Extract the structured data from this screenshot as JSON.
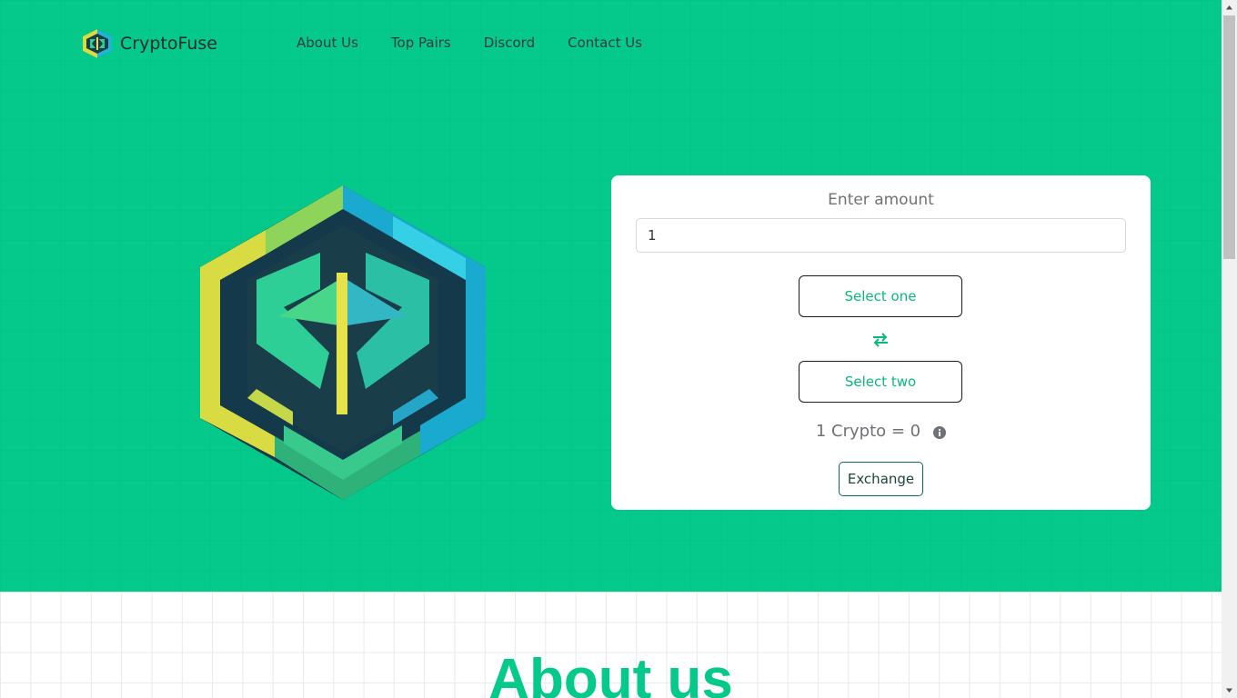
{
  "brand": {
    "name": "CryptoFuse",
    "logo_icon": "cryptofuse-logo-icon"
  },
  "nav": {
    "items": [
      {
        "label": "About Us"
      },
      {
        "label": "Top Pairs"
      },
      {
        "label": "Discord"
      },
      {
        "label": "Contact Us"
      }
    ]
  },
  "hero": {
    "logo_icon": "cryptofuse-hexagon-logo"
  },
  "exchange_card": {
    "title": "Enter amount",
    "amount_value": "1",
    "select_one_label": "Select one",
    "swap_icon": "swap-arrows-icon",
    "select_two_label": "Select two",
    "rate_text": "1 Crypto = 0",
    "info_icon": "info-circle-icon",
    "exchange_label": "Exchange"
  },
  "about": {
    "title": "About us"
  },
  "colors": {
    "accent": "#05c98a",
    "select_text": "#08b978",
    "card_bg": "#ffffff"
  }
}
